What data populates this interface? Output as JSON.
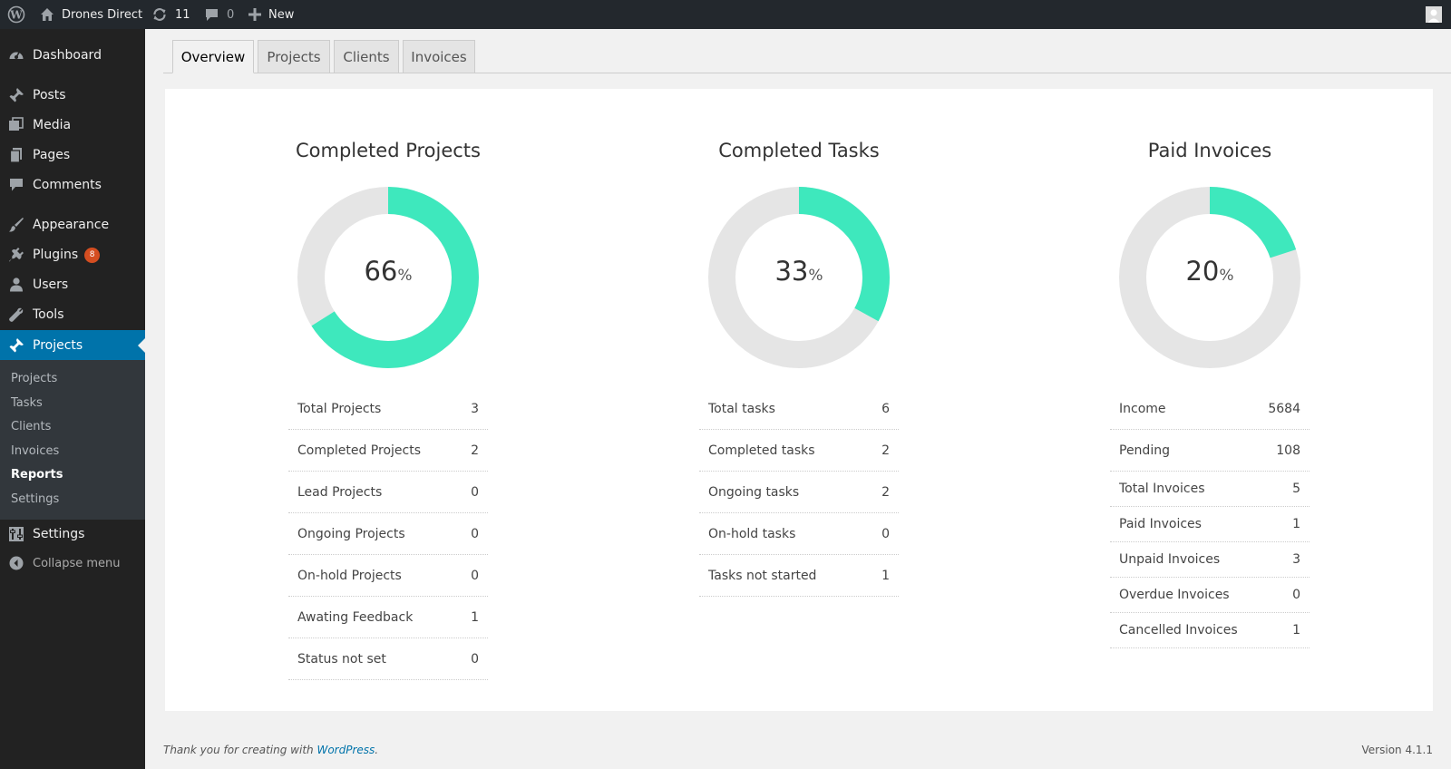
{
  "adminbar": {
    "site_name": "Drones Direct",
    "updates_count": "11",
    "comments_count": "0",
    "new_label": "New"
  },
  "sidebar": {
    "items": [
      {
        "label": "Dashboard",
        "icon": "dashboard-icon"
      },
      {
        "label": "Posts",
        "icon": "pin-icon"
      },
      {
        "label": "Media",
        "icon": "media-icon"
      },
      {
        "label": "Pages",
        "icon": "pages-icon"
      },
      {
        "label": "Comments",
        "icon": "comment-icon"
      },
      {
        "label": "Appearance",
        "icon": "brush-icon"
      },
      {
        "label": "Plugins",
        "icon": "plugin-icon",
        "badge": "8"
      },
      {
        "label": "Users",
        "icon": "user-icon"
      },
      {
        "label": "Tools",
        "icon": "wrench-icon"
      },
      {
        "label": "Projects",
        "icon": "pin-icon"
      },
      {
        "label": "Settings",
        "icon": "settings-icon"
      }
    ],
    "submenu": [
      "Projects",
      "Tasks",
      "Clients",
      "Invoices",
      "Reports",
      "Settings"
    ],
    "collapse_label": "Collapse menu"
  },
  "tabs": [
    "Overview",
    "Projects",
    "Clients",
    "Invoices"
  ],
  "colors": {
    "accent": "#3ee8bd",
    "track": "#e5e5e5",
    "current_menu": "#0073aa",
    "badge": "#d54e21"
  },
  "reports": [
    {
      "title": "Completed Projects",
      "percent": "66",
      "pct_sign": "%",
      "rows": [
        {
          "label": "Total Projects",
          "value": "3"
        },
        {
          "label": "Completed Projects",
          "value": "2"
        },
        {
          "label": "Lead Projects",
          "value": "0"
        },
        {
          "label": "Ongoing Projects",
          "value": "0"
        },
        {
          "label": "On-hold Projects",
          "value": "0"
        },
        {
          "label": "Awating Feedback",
          "value": "1"
        },
        {
          "label": "Status not set",
          "value": "0"
        }
      ]
    },
    {
      "title": "Completed Tasks",
      "percent": "33",
      "pct_sign": "%",
      "rows": [
        {
          "label": "Total tasks",
          "value": "6"
        },
        {
          "label": "Completed tasks",
          "value": "2"
        },
        {
          "label": "Ongoing tasks",
          "value": "2"
        },
        {
          "label": "On-hold tasks",
          "value": "0"
        },
        {
          "label": "Tasks not started",
          "value": "1"
        }
      ]
    },
    {
      "title": "Paid Invoices",
      "percent": "20",
      "pct_sign": "%",
      "rows": [
        {
          "label": "Income",
          "value": "5684"
        },
        {
          "label": "Pending",
          "value": "108"
        },
        {
          "label": "Total Invoices",
          "value": "5"
        },
        {
          "label": "Paid Invoices",
          "value": "1"
        },
        {
          "label": "Unpaid Invoices",
          "value": "3"
        },
        {
          "label": "Overdue Invoices",
          "value": "0"
        },
        {
          "label": "Cancelled Invoices",
          "value": "1"
        }
      ]
    }
  ],
  "footer": {
    "thanks_prefix": "Thank you for creating with ",
    "thanks_link": "WordPress",
    "thanks_suffix": ".",
    "version": "Version 4.1.1"
  }
}
